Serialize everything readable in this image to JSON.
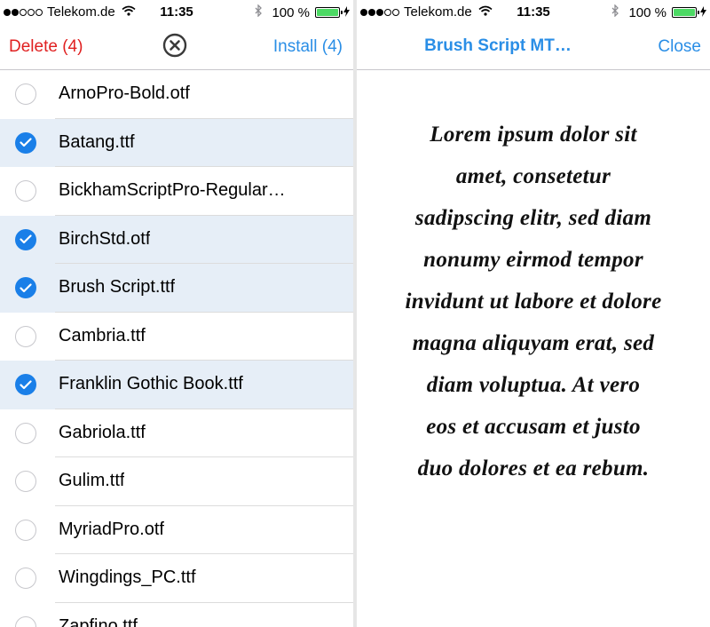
{
  "status_left": {
    "carrier": "Telekom.de",
    "time": "11:35",
    "battery": "100 %"
  },
  "status_right": {
    "carrier": "Telekom.de",
    "time": "11:35",
    "battery": "100 %"
  },
  "icons": {
    "wifi": "wifi-icon",
    "bluetooth": "bluetooth-icon",
    "battery": "battery-icon",
    "charging": "bolt-icon",
    "clear": "close-circle-icon",
    "checkbox": "checkmark-icon"
  },
  "colors": {
    "accent": "#2a8ee6",
    "delete": "#e02020",
    "selected_row": "#e6eef7",
    "checkbox": "#1a7fe8",
    "battery": "#4cd964"
  },
  "left_nav": {
    "delete_label": "Delete (4)",
    "install_label": "Install (4)"
  },
  "fonts": [
    {
      "name": "ArnoPro-Bold.otf",
      "selected": false
    },
    {
      "name": "Batang.ttf",
      "selected": true
    },
    {
      "name": "BickhamScriptPro-Regular…",
      "selected": false
    },
    {
      "name": "BirchStd.otf",
      "selected": true
    },
    {
      "name": "Brush Script.ttf",
      "selected": true
    },
    {
      "name": "Cambria.ttf",
      "selected": false
    },
    {
      "name": "Franklin Gothic Book.ttf",
      "selected": true
    },
    {
      "name": "Gabriola.ttf",
      "selected": false
    },
    {
      "name": "Gulim.ttf",
      "selected": false
    },
    {
      "name": "MyriadPro.otf",
      "selected": false
    },
    {
      "name": "Wingdings_PC.ttf",
      "selected": false
    },
    {
      "name": "Zapfino.ttf",
      "selected": false
    }
  ],
  "right_nav": {
    "title": "Brush Script MT…",
    "close_label": "Close"
  },
  "preview": {
    "lines": [
      "Lorem ipsum dolor sit",
      "amet, consetetur",
      "sadipscing elitr, sed diam",
      "nonumy eirmod tempor",
      "invidunt ut labore et dolore",
      "magna aliquyam erat, sed",
      "diam voluptua. At vero",
      "eos et accusam et justo",
      "duo dolores et ea rebum."
    ]
  }
}
